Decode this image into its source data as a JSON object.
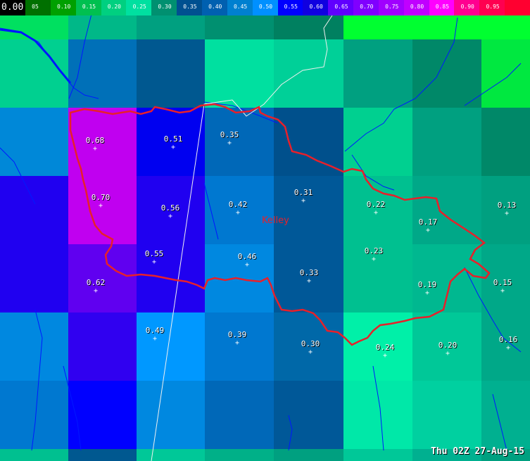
{
  "legend": {
    "first_label": "0.00",
    "labels": [
      "05",
      "0.10",
      "0.15",
      "0.20",
      "0.25",
      "0.30",
      "0.35",
      "0.40",
      "0.45",
      "0.50",
      "0.55",
      "0.60",
      "0.65",
      "0.70",
      "0.75",
      "0.80",
      "0.85",
      "0.90",
      "0.95"
    ],
    "colors": [
      "#007000",
      "#00a000",
      "#00c050",
      "#00d080",
      "#00e0a0",
      "#009070",
      "#005090",
      "#0060b0",
      "#0080d0",
      "#0090ff",
      "#0000ff",
      "#1000e0",
      "#6000ff",
      "#8000ff",
      "#a000ff",
      "#c000ff",
      "#ff00ff",
      "#ff0090",
      "#ff0050",
      "#ff0030"
    ]
  },
  "grid_colors": [
    [
      "#00e060",
      "#00b888",
      "#00a080",
      "#009070",
      "#008060",
      "#00ff30",
      "#00ff30",
      "#00ff30"
    ],
    [
      "#00d090",
      "#0070b8",
      "#005890",
      "#00e0a0",
      "#00d098",
      "#00a080",
      "#008868",
      "#00e840"
    ],
    [
      "#0088d8",
      "#c000f0",
      "#0000f0",
      "#0068b8",
      "#00508c",
      "#00d090",
      "#00a080",
      "#008868"
    ],
    [
      "#2000f0",
      "#c000f0",
      "#2000f0",
      "#0078d0",
      "#005898",
      "#00c090",
      "#00a888",
      "#00a080"
    ],
    [
      "#2000f0",
      "#6000f0",
      "#2000f0",
      "#0088e0",
      "#005898",
      "#00c090",
      "#00b890",
      "#00a888"
    ],
    [
      "#0088e0",
      "#3000f0",
      "#0098ff",
      "#0078d0",
      "#0068a8",
      "#00f0a8",
      "#00c898",
      "#00a888"
    ],
    [
      "#0078d0",
      "#0000ff",
      "#0088e0",
      "#0068b8",
      "#005898",
      "#00e8a8",
      "#00d0a0",
      "#00b090"
    ],
    [
      "#00c090",
      "#005890",
      "#00c898",
      "#00b088",
      "#00a080",
      "#00c898",
      "#00b090",
      "#00a080"
    ]
  ],
  "values": [
    {
      "label": "0.68"
    },
    {
      "label": "0.51"
    },
    {
      "label": "0.35"
    },
    {
      "label": "0.70"
    },
    {
      "label": "0.56"
    },
    {
      "label": "0.42"
    },
    {
      "label": "0.31"
    },
    {
      "label": "0.22"
    },
    {
      "label": "0.13"
    },
    {
      "label": "0.17"
    },
    {
      "label": "0.55"
    },
    {
      "label": "0.46"
    },
    {
      "label": "0.23"
    },
    {
      "label": "0.62"
    },
    {
      "label": "0.33"
    },
    {
      "label": "0.19"
    },
    {
      "label": "0.15"
    },
    {
      "label": "0.49"
    },
    {
      "label": "0.39"
    },
    {
      "label": "0.30"
    },
    {
      "label": "0.24"
    },
    {
      "label": "0.20"
    },
    {
      "label": "0.16"
    }
  ],
  "county_label": "Kelley",
  "timestamp": "Thu 02Z 27-Aug-15"
}
